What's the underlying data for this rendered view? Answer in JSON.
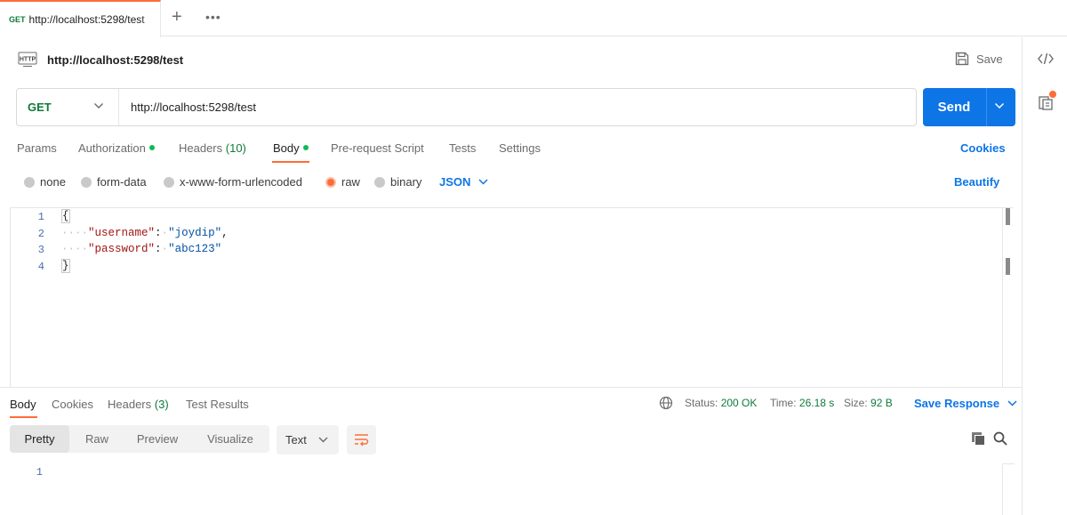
{
  "tabs": [
    {
      "method": "GET",
      "url": "http://localhost:5298/test"
    }
  ],
  "request": {
    "title": "http://localhost:5298/test",
    "save_label": "Save",
    "method": "GET",
    "url": "http://localhost:5298/test",
    "send_label": "Send"
  },
  "request_tabs": {
    "params": "Params",
    "authorization": "Authorization",
    "headers": "Headers",
    "headers_count": "(10)",
    "body": "Body",
    "pre_request": "Pre-request Script",
    "tests": "Tests",
    "settings": "Settings",
    "cookies": "Cookies"
  },
  "body_types": {
    "none": "none",
    "form_data": "form-data",
    "urlencoded": "x-www-form-urlencoded",
    "raw": "raw",
    "binary": "binary",
    "format": "JSON",
    "beautify": "Beautify"
  },
  "editor": {
    "line_numbers": [
      "1",
      "2",
      "3",
      "4"
    ],
    "open_brace": "{",
    "close_brace": "}",
    "key1": "\"username\"",
    "val1": "\"joydip\"",
    "key2": "\"password\"",
    "val2": "\"abc123\""
  },
  "response": {
    "tabs": {
      "body": "Body",
      "cookies": "Cookies",
      "headers": "Headers",
      "headers_count": "(3)",
      "test_results": "Test Results"
    },
    "status_label": "Status:",
    "status_value": "200 OK",
    "time_label": "Time:",
    "time_value": "26.18 s",
    "size_label": "Size:",
    "size_value": "92 B",
    "save_response": "Save Response",
    "views": [
      "Pretty",
      "Raw",
      "Preview",
      "Visualize"
    ],
    "format": "Text",
    "line_numbers": [
      "1"
    ]
  },
  "colors": {
    "accent": "#ff6c37",
    "primary": "#0d75e6",
    "method_get": "#0f7a3a",
    "status_ok": "#0cbb52"
  }
}
